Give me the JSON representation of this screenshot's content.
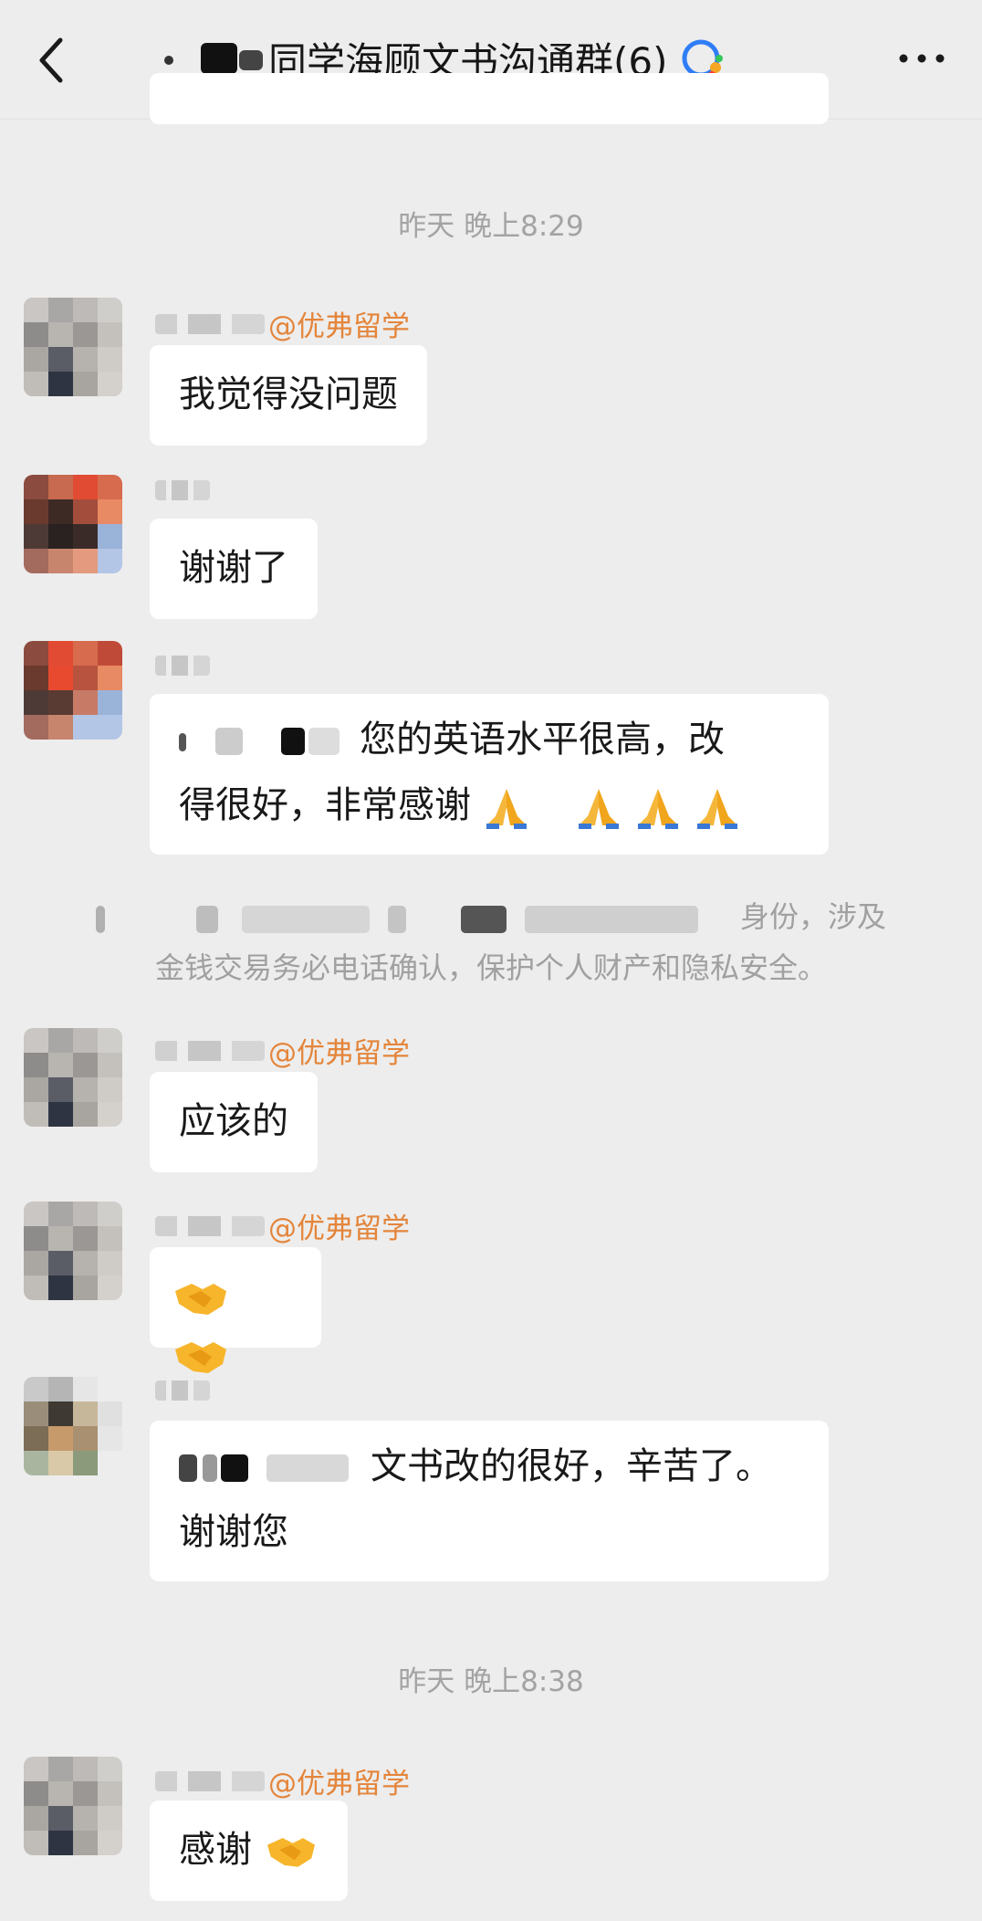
{
  "header": {
    "title": "同学海顾文书沟通群(6)",
    "back_icon": "chevron-left-icon",
    "more_icon": "more-dots-icon",
    "group_icon": "group-chat-icon"
  },
  "timestamps": [
    "昨天 晚上8:29",
    "昨天 晚上8:38"
  ],
  "messages": [
    {
      "sender": "@优弗留学",
      "text": "我觉得没问题"
    },
    {
      "sender": "",
      "text": "谢谢了"
    },
    {
      "sender": "",
      "line1": "您的英语水平很高，改",
      "line2": "得很好，非常感谢"
    },
    {
      "sender": "@优弗留学",
      "text": "应该的"
    },
    {
      "sender": "@优弗留学",
      "text": ""
    },
    {
      "sender": "",
      "line1": "文书改的很好，辛苦了。",
      "line2": "谢谢您"
    },
    {
      "sender": "@优弗留学",
      "text": "感谢"
    }
  ],
  "notice": {
    "line1": "身份，涉及",
    "line2": "金钱交易务必电话确认，保护个人财产和隐私安全。"
  },
  "colors": {
    "background": "#ededed",
    "bubble": "#ffffff",
    "sender": "#e4853b",
    "meta": "#a3a3a3"
  }
}
